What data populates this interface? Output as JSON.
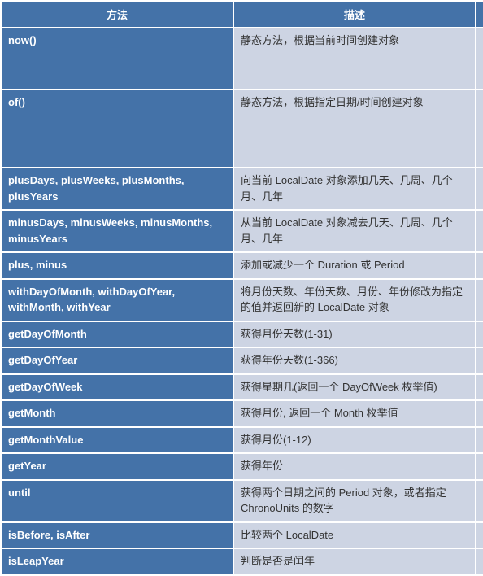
{
  "headers": {
    "method": "方法",
    "description": "描述"
  },
  "rows": [
    {
      "method": "now()",
      "desc": "静态方法，根据当前时间创建对象"
    },
    {
      "method": "of()",
      "desc": "静态方法，根据指定日期/时间创建对象"
    },
    {
      "method": "plusDays, plusWeeks, plusMonths, plusYears",
      "desc": "向当前 LocalDate 对象添加几天、几周、几个月、几年"
    },
    {
      "method": "minusDays, minusWeeks, minusMonths, minusYears",
      "desc": "从当前 LocalDate 对象减去几天、几周、几个月、几年"
    },
    {
      "method": "plus, minus",
      "desc": "添加或减少一个 Duration 或 Period"
    },
    {
      "method": "withDayOfMonth, withDayOfYear, withMonth, withYear",
      "desc": "将月份天数、年份天数、月份、年份修改为指定的值并返回新的 LocalDate 对象"
    },
    {
      "method": "getDayOfMonth",
      "desc": "获得月份天数(1-31)"
    },
    {
      "method": "getDayOfYear",
      "desc": "获得年份天数(1-366)"
    },
    {
      "method": "getDayOfWeek",
      "desc": "获得星期几(返回一个 DayOfWeek 枚举值)"
    },
    {
      "method": "getMonth",
      "desc": "获得月份, 返回一个 Month 枚举值"
    },
    {
      "method": "getMonthValue",
      "desc": "获得月份(1-12)"
    },
    {
      "method": "getYear",
      "desc": "获得年份"
    },
    {
      "method": "until",
      "desc": "获得两个日期之间的 Period 对象，或者指定 ChronoUnits 的数字"
    },
    {
      "method": "isBefore, isAfter",
      "desc": "比较两个 LocalDate"
    },
    {
      "method": "isLeapYear",
      "desc": "判断是否是闰年"
    }
  ]
}
